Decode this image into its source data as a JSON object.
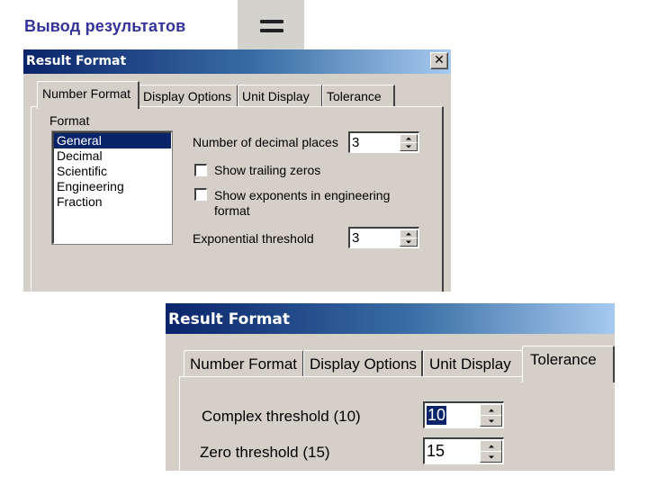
{
  "slide": {
    "title": "Вывод результатов",
    "equals_icon": "equals-icon"
  },
  "dialog1": {
    "title": "Result Format",
    "close_glyph": "✕",
    "tabs": [
      {
        "label": "Number Format",
        "active": true
      },
      {
        "label": "Display Options",
        "active": false
      },
      {
        "label": "Unit Display",
        "active": false
      },
      {
        "label": "Tolerance",
        "active": false
      }
    ],
    "format_label": "Format",
    "format_options": [
      "General",
      "Decimal",
      "Scientific",
      "Engineering",
      "Fraction"
    ],
    "format_selected": "General",
    "decimal_places": {
      "label": "Number of decimal places",
      "value": "3"
    },
    "show_trailing_zeros": {
      "label": "Show trailing zeros",
      "checked": false
    },
    "show_exponents": {
      "label_line1": "Show exponents in engineering",
      "label_line2": "format",
      "checked": false
    },
    "exponential_threshold": {
      "label": "Exponential threshold",
      "value": "3"
    }
  },
  "dialog2": {
    "title": "Result Format",
    "tabs": [
      {
        "label": "Number Format",
        "active": false
      },
      {
        "label": "Display Options",
        "active": false
      },
      {
        "label": "Unit Display",
        "active": false
      },
      {
        "label": "Tolerance",
        "active": true
      }
    ],
    "complex_threshold": {
      "label": "Complex threshold (10)",
      "value": "10"
    },
    "zero_threshold": {
      "label": "Zero threshold (15)",
      "value": "15"
    }
  }
}
